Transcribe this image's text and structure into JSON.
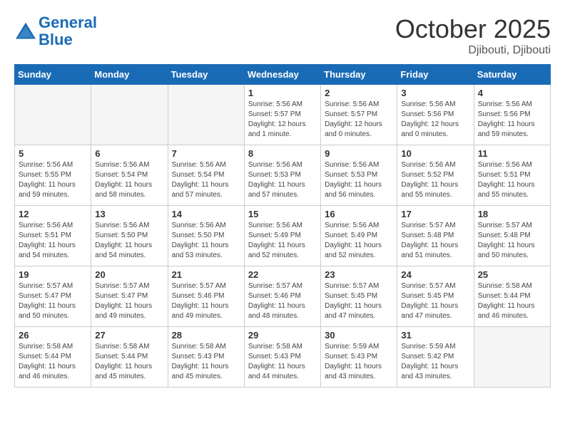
{
  "header": {
    "logo_line1": "General",
    "logo_line2": "Blue",
    "month": "October 2025",
    "location": "Djibouti, Djibouti"
  },
  "weekdays": [
    "Sunday",
    "Monday",
    "Tuesday",
    "Wednesday",
    "Thursday",
    "Friday",
    "Saturday"
  ],
  "weeks": [
    [
      {
        "day": "",
        "info": ""
      },
      {
        "day": "",
        "info": ""
      },
      {
        "day": "",
        "info": ""
      },
      {
        "day": "1",
        "info": "Sunrise: 5:56 AM\nSunset: 5:57 PM\nDaylight: 12 hours\nand 1 minute."
      },
      {
        "day": "2",
        "info": "Sunrise: 5:56 AM\nSunset: 5:57 PM\nDaylight: 12 hours\nand 0 minutes."
      },
      {
        "day": "3",
        "info": "Sunrise: 5:56 AM\nSunset: 5:56 PM\nDaylight: 12 hours\nand 0 minutes."
      },
      {
        "day": "4",
        "info": "Sunrise: 5:56 AM\nSunset: 5:56 PM\nDaylight: 11 hours\nand 59 minutes."
      }
    ],
    [
      {
        "day": "5",
        "info": "Sunrise: 5:56 AM\nSunset: 5:55 PM\nDaylight: 11 hours\nand 59 minutes."
      },
      {
        "day": "6",
        "info": "Sunrise: 5:56 AM\nSunset: 5:54 PM\nDaylight: 11 hours\nand 58 minutes."
      },
      {
        "day": "7",
        "info": "Sunrise: 5:56 AM\nSunset: 5:54 PM\nDaylight: 11 hours\nand 57 minutes."
      },
      {
        "day": "8",
        "info": "Sunrise: 5:56 AM\nSunset: 5:53 PM\nDaylight: 11 hours\nand 57 minutes."
      },
      {
        "day": "9",
        "info": "Sunrise: 5:56 AM\nSunset: 5:53 PM\nDaylight: 11 hours\nand 56 minutes."
      },
      {
        "day": "10",
        "info": "Sunrise: 5:56 AM\nSunset: 5:52 PM\nDaylight: 11 hours\nand 55 minutes."
      },
      {
        "day": "11",
        "info": "Sunrise: 5:56 AM\nSunset: 5:51 PM\nDaylight: 11 hours\nand 55 minutes."
      }
    ],
    [
      {
        "day": "12",
        "info": "Sunrise: 5:56 AM\nSunset: 5:51 PM\nDaylight: 11 hours\nand 54 minutes."
      },
      {
        "day": "13",
        "info": "Sunrise: 5:56 AM\nSunset: 5:50 PM\nDaylight: 11 hours\nand 54 minutes."
      },
      {
        "day": "14",
        "info": "Sunrise: 5:56 AM\nSunset: 5:50 PM\nDaylight: 11 hours\nand 53 minutes."
      },
      {
        "day": "15",
        "info": "Sunrise: 5:56 AM\nSunset: 5:49 PM\nDaylight: 11 hours\nand 52 minutes."
      },
      {
        "day": "16",
        "info": "Sunrise: 5:56 AM\nSunset: 5:49 PM\nDaylight: 11 hours\nand 52 minutes."
      },
      {
        "day": "17",
        "info": "Sunrise: 5:57 AM\nSunset: 5:48 PM\nDaylight: 11 hours\nand 51 minutes."
      },
      {
        "day": "18",
        "info": "Sunrise: 5:57 AM\nSunset: 5:48 PM\nDaylight: 11 hours\nand 50 minutes."
      }
    ],
    [
      {
        "day": "19",
        "info": "Sunrise: 5:57 AM\nSunset: 5:47 PM\nDaylight: 11 hours\nand 50 minutes."
      },
      {
        "day": "20",
        "info": "Sunrise: 5:57 AM\nSunset: 5:47 PM\nDaylight: 11 hours\nand 49 minutes."
      },
      {
        "day": "21",
        "info": "Sunrise: 5:57 AM\nSunset: 5:46 PM\nDaylight: 11 hours\nand 49 minutes."
      },
      {
        "day": "22",
        "info": "Sunrise: 5:57 AM\nSunset: 5:46 PM\nDaylight: 11 hours\nand 48 minutes."
      },
      {
        "day": "23",
        "info": "Sunrise: 5:57 AM\nSunset: 5:45 PM\nDaylight: 11 hours\nand 47 minutes."
      },
      {
        "day": "24",
        "info": "Sunrise: 5:57 AM\nSunset: 5:45 PM\nDaylight: 11 hours\nand 47 minutes."
      },
      {
        "day": "25",
        "info": "Sunrise: 5:58 AM\nSunset: 5:44 PM\nDaylight: 11 hours\nand 46 minutes."
      }
    ],
    [
      {
        "day": "26",
        "info": "Sunrise: 5:58 AM\nSunset: 5:44 PM\nDaylight: 11 hours\nand 46 minutes."
      },
      {
        "day": "27",
        "info": "Sunrise: 5:58 AM\nSunset: 5:44 PM\nDaylight: 11 hours\nand 45 minutes."
      },
      {
        "day": "28",
        "info": "Sunrise: 5:58 AM\nSunset: 5:43 PM\nDaylight: 11 hours\nand 45 minutes."
      },
      {
        "day": "29",
        "info": "Sunrise: 5:58 AM\nSunset: 5:43 PM\nDaylight: 11 hours\nand 44 minutes."
      },
      {
        "day": "30",
        "info": "Sunrise: 5:59 AM\nSunset: 5:43 PM\nDaylight: 11 hours\nand 43 minutes."
      },
      {
        "day": "31",
        "info": "Sunrise: 5:59 AM\nSunset: 5:42 PM\nDaylight: 11 hours\nand 43 minutes."
      },
      {
        "day": "",
        "info": ""
      }
    ]
  ]
}
